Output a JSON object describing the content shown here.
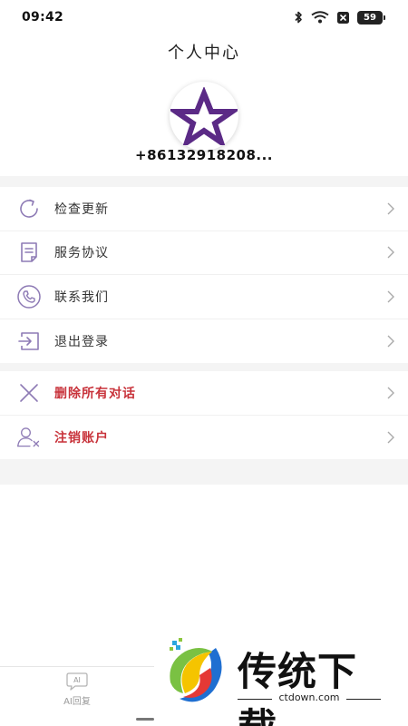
{
  "status_bar": {
    "time": "09:42",
    "battery": "59"
  },
  "header": {
    "title": "个人中心"
  },
  "profile": {
    "phone": "+86132918208..."
  },
  "menu_main": [
    {
      "label": "检查更新",
      "icon": "refresh-icon"
    },
    {
      "label": "服务协议",
      "icon": "document-icon"
    },
    {
      "label": "联系我们",
      "icon": "phone-icon"
    },
    {
      "label": "退出登录",
      "icon": "logout-icon"
    }
  ],
  "menu_danger": [
    {
      "label": "删除所有对话",
      "icon": "close-icon"
    },
    {
      "label": "注销账户",
      "icon": "user-remove-icon"
    }
  ],
  "bottom_nav": {
    "tab_label": "AI回复",
    "tab_icon_text": "AI"
  },
  "watermark": {
    "brand": "传统下载",
    "url": "ctdown.com"
  },
  "colors": {
    "accent_purple": "#5b2a86",
    "danger_red": "#c8333b",
    "icon_purple": "#8e7bb5"
  }
}
